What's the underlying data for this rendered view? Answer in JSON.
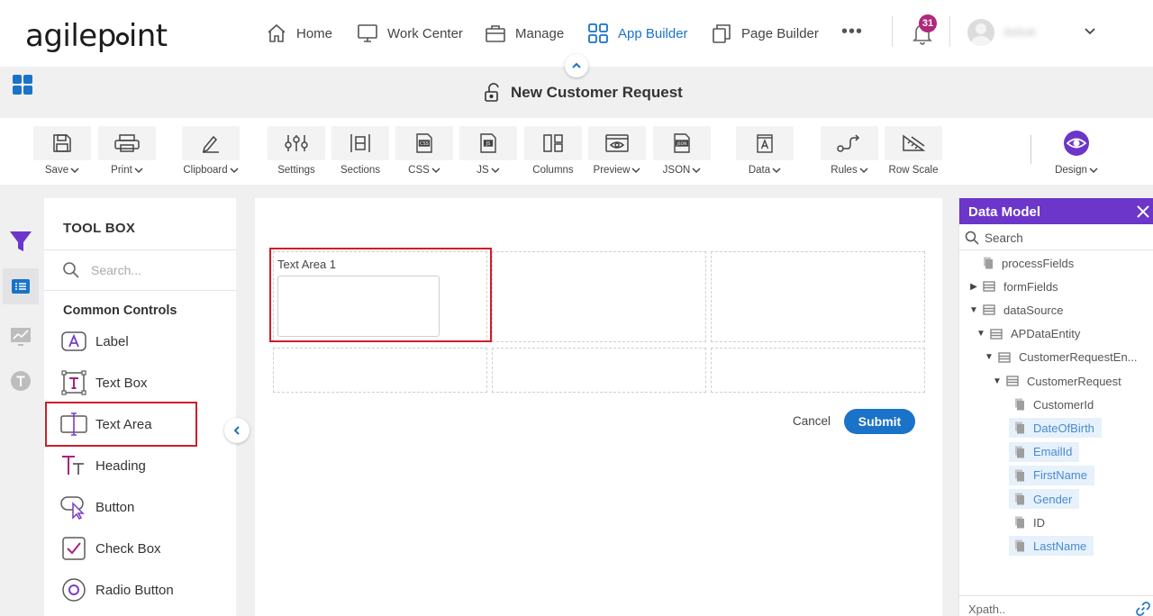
{
  "brand": {
    "logo_text_left": "agilep",
    "logo_text_right": "int"
  },
  "nav": {
    "items": [
      {
        "label": "Home",
        "icon": "home-icon"
      },
      {
        "label": "Work Center",
        "icon": "monitor-icon"
      },
      {
        "label": "Manage",
        "icon": "briefcase-icon"
      },
      {
        "label": "App Builder",
        "icon": "grid-icon",
        "active": true
      },
      {
        "label": "Page Builder",
        "icon": "pages-icon"
      }
    ],
    "more": "•••",
    "notifications_count": "31",
    "user_name": "Ashok"
  },
  "page": {
    "title": "New Customer Request"
  },
  "ribbon": {
    "items": [
      {
        "label": "Save",
        "dropdown": true,
        "icon": "save-icon"
      },
      {
        "label": "Print",
        "dropdown": true,
        "icon": "print-icon"
      },
      {
        "label": "Clipboard",
        "dropdown": true,
        "icon": "clipboard-icon"
      },
      {
        "label": "Settings",
        "dropdown": false,
        "icon": "settings-sliders-icon"
      },
      {
        "label": "Sections",
        "dropdown": false,
        "icon": "sections-icon"
      },
      {
        "label": "CSS",
        "dropdown": true,
        "icon": "css-file-icon"
      },
      {
        "label": "JS",
        "dropdown": true,
        "icon": "js-file-icon"
      },
      {
        "label": "Columns",
        "dropdown": false,
        "icon": "columns-icon"
      },
      {
        "label": "Preview",
        "dropdown": true,
        "icon": "preview-icon"
      },
      {
        "label": "JSON",
        "dropdown": true,
        "icon": "json-file-icon"
      },
      {
        "label": "Data",
        "dropdown": true,
        "icon": "data-icon"
      },
      {
        "label": "Rules",
        "dropdown": true,
        "icon": "rules-icon"
      },
      {
        "label": "Row Scale",
        "dropdown": false,
        "icon": "row-scale-icon"
      },
      {
        "label": "Design",
        "dropdown": true,
        "icon": "design-eye-icon"
      }
    ]
  },
  "toolbox": {
    "title": "TOOL BOX",
    "search_placeholder": "Search...",
    "section": "Common Controls",
    "items": [
      {
        "label": "Label",
        "icon": "label-icon"
      },
      {
        "label": "Text Box",
        "icon": "text-box-icon"
      },
      {
        "label": "Text Area",
        "icon": "text-area-icon",
        "highlighted": true
      },
      {
        "label": "Heading",
        "icon": "heading-icon"
      },
      {
        "label": "Button",
        "icon": "button-icon"
      },
      {
        "label": "Check Box",
        "icon": "check-box-icon"
      },
      {
        "label": "Radio Button",
        "icon": "radio-button-icon"
      }
    ]
  },
  "form": {
    "text_area_label": "Text Area 1",
    "cancel_label": "Cancel",
    "submit_label": "Submit"
  },
  "data_model": {
    "title": "Data Model",
    "search_placeholder": "Search",
    "xpath_placeholder": "Xpath..",
    "tree": [
      {
        "label": "processFields",
        "level": 0,
        "arrow": "",
        "type": "leaf-doc",
        "hl": false
      },
      {
        "label": "formFields",
        "level": 0,
        "arrow": "▶",
        "type": "group",
        "hl": false
      },
      {
        "label": "dataSource",
        "level": 0,
        "arrow": "▼",
        "type": "group",
        "hl": false
      },
      {
        "label": "APDataEntity",
        "level": 1,
        "arrow": "▼",
        "type": "group",
        "hl": false
      },
      {
        "label": "CustomerRequestEn...",
        "level": 2,
        "arrow": "▼",
        "type": "group",
        "hl": false
      },
      {
        "label": "CustomerRequest",
        "level": 3,
        "arrow": "▼",
        "type": "group",
        "hl": false
      },
      {
        "label": "CustomerId",
        "level": 4,
        "arrow": "",
        "type": "leaf-doc",
        "hl": false
      },
      {
        "label": "DateOfBirth",
        "level": 4,
        "arrow": "",
        "type": "leaf-doc",
        "hl": true
      },
      {
        "label": "EmailId",
        "level": 4,
        "arrow": "",
        "type": "leaf-doc",
        "hl": true
      },
      {
        "label": "FirstName",
        "level": 4,
        "arrow": "",
        "type": "leaf-doc",
        "hl": true
      },
      {
        "label": "Gender",
        "level": 4,
        "arrow": "",
        "type": "leaf-doc",
        "hl": true
      },
      {
        "label": "ID",
        "level": 4,
        "arrow": "",
        "type": "leaf-doc",
        "hl": false
      },
      {
        "label": "LastName",
        "level": 4,
        "arrow": "",
        "type": "leaf-doc",
        "hl": true
      }
    ]
  },
  "colors": {
    "accent": "#1a73c8",
    "purple": "#6b36c9",
    "highlight_red": "#cc1f2a",
    "badge": "#b0287a"
  }
}
